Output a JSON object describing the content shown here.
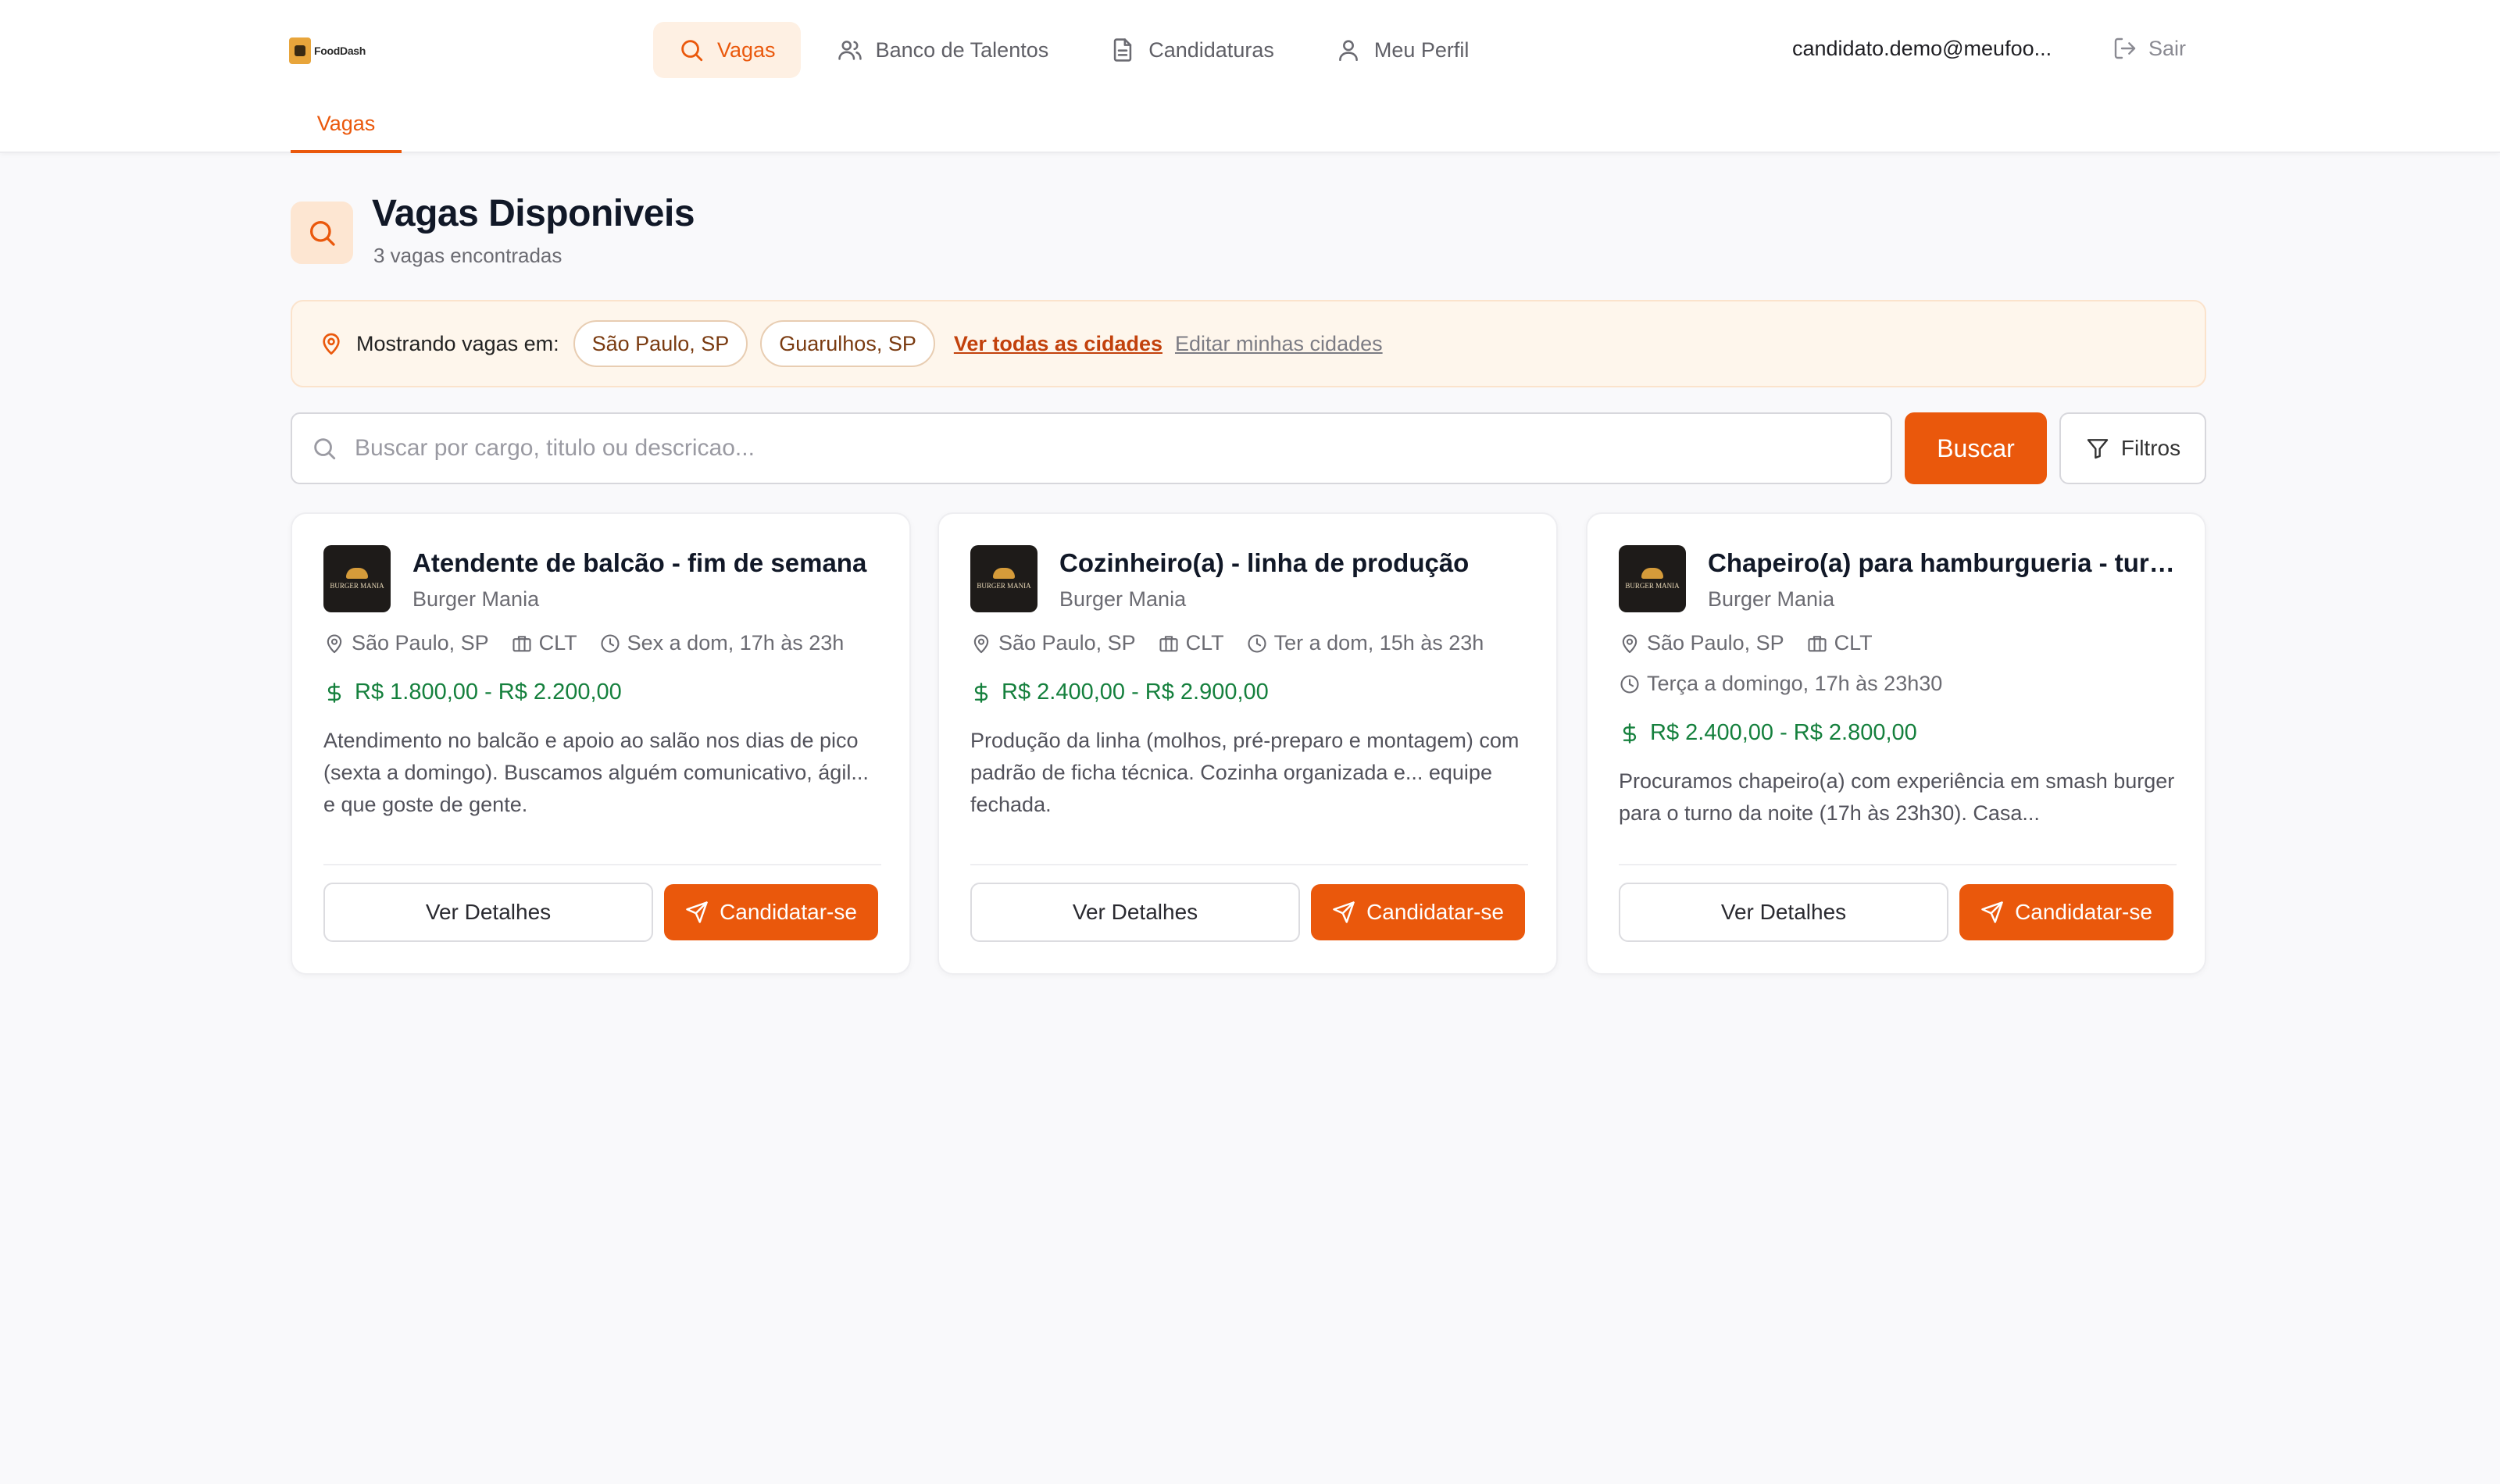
{
  "app": {
    "logo_text": "FoodDash"
  },
  "nav": {
    "items": [
      {
        "label": "Vagas",
        "icon": "search-icon",
        "active": true
      },
      {
        "label": "Banco de Talentos",
        "icon": "users-icon",
        "active": false
      },
      {
        "label": "Candidaturas",
        "icon": "document-icon",
        "active": false
      },
      {
        "label": "Meu Perfil",
        "icon": "user-icon",
        "active": false
      }
    ]
  },
  "user": {
    "email": "candidato.demo@meufoo...",
    "logout_label": "Sair"
  },
  "subnav": {
    "active_tab": "Vagas"
  },
  "page": {
    "title": "Vagas Disponiveis",
    "subtitle": "3 vagas encontradas"
  },
  "cities": {
    "label": "Mostrando vagas em:",
    "chips": [
      "São Paulo, SP",
      "Guarulhos, SP"
    ],
    "view_all": "Ver todas as cidades",
    "edit": "Editar minhas cidades"
  },
  "search": {
    "placeholder": "Buscar por cargo, titulo ou descricao...",
    "value": "",
    "button_label": "Buscar",
    "filters_label": "Filtros"
  },
  "jobs": [
    {
      "title": "Atendente de balcão - fim de semana",
      "company": "Burger Mania",
      "location": "São Paulo, SP",
      "contract": "CLT",
      "schedule": "Sex a dom, 17h às 23h",
      "salary": "R$ 1.800,00 - R$ 2.200,00",
      "description": "Atendimento no balcão e apoio ao salão nos dias de pico (sexta a domingo). Buscamos alguém comunicativo, ágil... e que goste de gente.",
      "details_label": "Ver Detalhes",
      "apply_label": "Candidatar-se"
    },
    {
      "title": "Cozinheiro(a) - linha de produção",
      "company": "Burger Mania",
      "location": "São Paulo, SP",
      "contract": "CLT",
      "schedule": "Ter a dom, 15h às 23h",
      "salary": "R$ 2.400,00 - R$ 2.900,00",
      "description": "Produção da linha (molhos, pré-preparo e montagem) com padrão de ficha técnica. Cozinha organizada e... equipe fechada.",
      "details_label": "Ver Detalhes",
      "apply_label": "Candidatar-se"
    },
    {
      "title": "Chapeiro(a) para hamburgueria - turn...",
      "company": "Burger Mania",
      "location": "São Paulo, SP",
      "contract": "CLT",
      "schedule": "Terça a domingo, 17h às 23h30",
      "salary": "R$ 2.400,00 - R$ 2.800,00",
      "description": "Procuramos chapeiro(a) com experiência em smash burger para o turno da noite (17h às 23h30). Casa...",
      "details_label": "Ver Detalhes",
      "apply_label": "Candidatar-se"
    }
  ],
  "company_logo_text": "BURGER MANIA",
  "colors": {
    "accent": "#EA580C",
    "salary": "#15803D",
    "banner_bg": "#FEF6EC"
  }
}
